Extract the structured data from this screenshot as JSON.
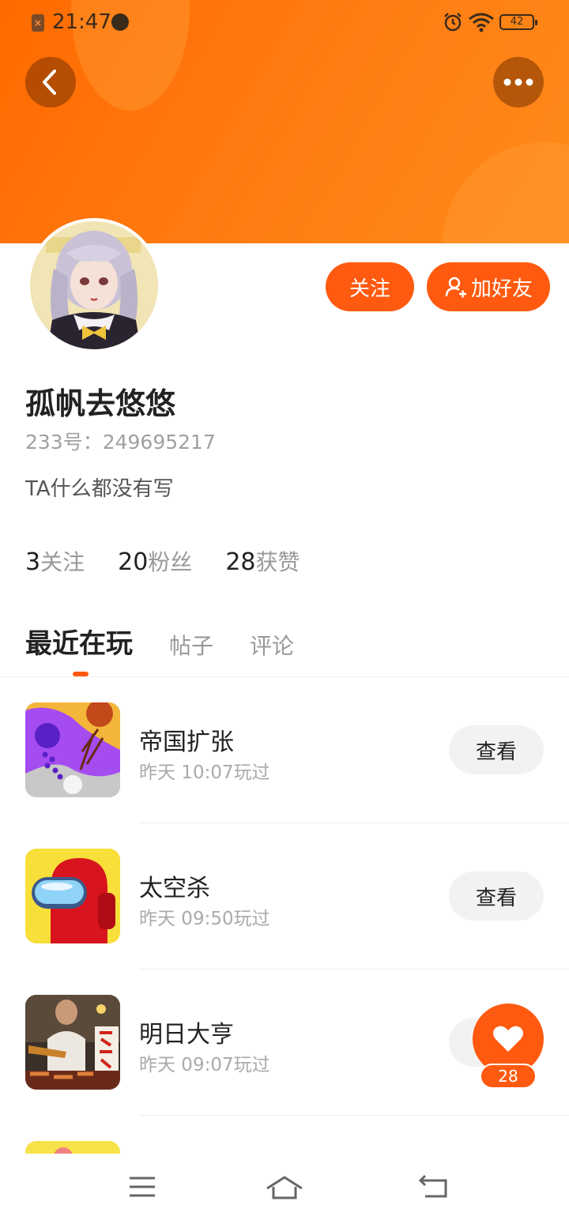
{
  "status_bar": {
    "time": "21:47",
    "battery": "42"
  },
  "profile": {
    "nickname": "孤帆去悠悠",
    "uid_text": "233号：249695217",
    "bio": "TA什么都没有写",
    "follow_label": "关注",
    "add_friend_label": "加好友",
    "stats": [
      {
        "value": "3",
        "label": "关注"
      },
      {
        "value": "20",
        "label": "粉丝"
      },
      {
        "value": "28",
        "label": "获赞"
      }
    ]
  },
  "tabs": [
    {
      "label": "最近在玩",
      "active": true
    },
    {
      "label": "帖子",
      "active": false
    },
    {
      "label": "评论",
      "active": false
    }
  ],
  "games": [
    {
      "name": "帝国扩张",
      "played": "昨天 10:07玩过",
      "button": "查看",
      "icon": "empire-expansion-icon"
    },
    {
      "name": "太空杀",
      "played": "昨天 09:50玩过",
      "button": "查看",
      "icon": "space-kill-icon"
    },
    {
      "name": "明日大亨",
      "played": "昨天 09:07玩过",
      "button": "查看",
      "icon": "tomorrow-tycoon-icon"
    }
  ],
  "like_fab": {
    "count": "28"
  },
  "colors": {
    "accent": "#ff5a0f",
    "header": "#ff7a10"
  }
}
